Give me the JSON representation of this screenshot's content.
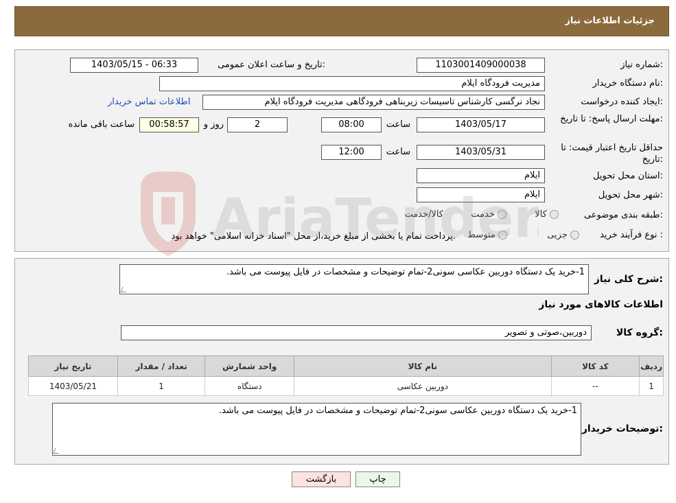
{
  "header": {
    "title": "جزئیات اطلاعات نیاز"
  },
  "form": {
    "need_number_label": "شماره نیاز:",
    "need_number": "1103001409000038",
    "announce_label": "تاریخ و ساعت اعلان عمومی:",
    "announce_value": "1403/05/15 - 06:33",
    "buyer_org_label": "نام دستگاه خریدار:",
    "buyer_org": "مدیریت فرودگاه ایلام",
    "creator_label": "ایجاد کننده درخواست:",
    "creator": "نجاد نرگسی کارشناس تاسیسات زیربناهی فرودگاهی مدیریت فرودگاه ایلام",
    "contact_link": "اطلاعات تماس خریدار",
    "deadline_label": "مهلت ارسال پاسخ: تا تاریخ:",
    "deadline_date": "1403/05/17",
    "time_label": "ساعت",
    "deadline_time": "08:00",
    "days_value": "2",
    "days_label": "روز و",
    "remaining_time": "00:58:57",
    "remaining_label": "ساعت باقی مانده",
    "validity_label": "حداقل تاریخ اعتبار قیمت: تا تاریخ:",
    "validity_date": "1403/05/31",
    "validity_time": "12:00",
    "province_label": "استان محل تحویل:",
    "province": "ایلام",
    "city_label": "شهر محل تحویل:",
    "city": "ایلام",
    "category_label": "طبقه بندی موضوعی:",
    "category_options": [
      "کالا",
      "خدمت",
      "کالا/خدمت"
    ],
    "process_label": "نوع فرآیند خرید :",
    "process_options": [
      "جزیی",
      "متوسط"
    ],
    "process_note": "پرداخت تمام یا بخشی از مبلغ خرید،از محل \"اسناد خزانه اسلامی\" خواهد بود."
  },
  "details": {
    "summary_label": "شرح کلی نیاز:",
    "summary": "1-خرید یک دستگاه دوربین عکاسی سونی2-تمام توضیحات و مشخصات در فایل پیوست می باشد.",
    "goods_info_title": "اطلاعات کالاهای مورد نیاز",
    "goods_group_label": "گروه کالا:",
    "goods_group": "دوربین،صوتی و تصویر",
    "table": {
      "headers": [
        "ردیف",
        "کد کالا",
        "نام کالا",
        "واحد شمارش",
        "تعداد / مقدار",
        "تاریخ نیاز"
      ],
      "rows": [
        [
          "1",
          "--",
          "دوربین عکاسی",
          "دستگاه",
          "1",
          "1403/05/21"
        ]
      ]
    },
    "buyer_notes_label": "توضیحات خریدار:",
    "buyer_notes": "1-خرید یک دستگاه دوربین عکاسی سونی2-تمام توضیحات و مشخصات در فایل پیوست می باشد."
  },
  "buttons": {
    "back": "بازگشت",
    "print": "چاپ"
  },
  "watermark": {
    "text": "AriaTender.neT"
  },
  "colors": {
    "header": "#8b6b3d",
    "panel": "#f2f2f2",
    "link": "#1a4fb5"
  }
}
